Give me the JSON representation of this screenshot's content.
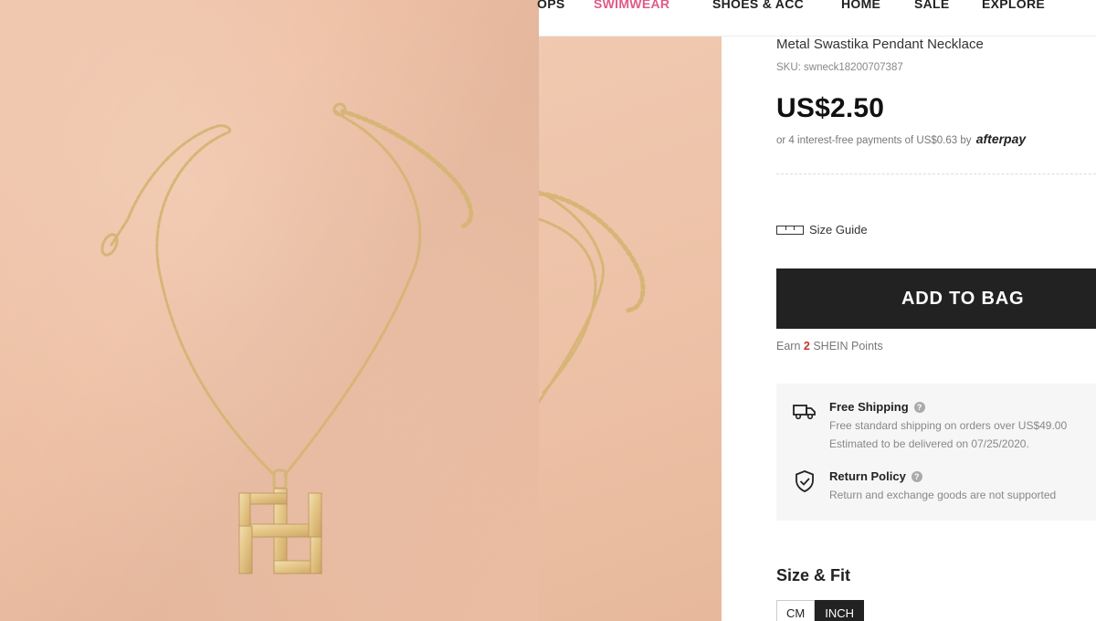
{
  "nav": {
    "items": [
      {
        "label": "OPS",
        "accent": false
      },
      {
        "label": "SWIMWEAR",
        "accent": true
      },
      {
        "label": "SHOES & ACC",
        "accent": false
      },
      {
        "label": "HOME",
        "accent": false
      },
      {
        "label": "SALE",
        "accent": false
      },
      {
        "label": "EXPLORE",
        "accent": false
      }
    ],
    "accent_color": "#e05b86"
  },
  "product": {
    "title": "Metal Swastika Pendant Necklace",
    "sku": "SKU: swneck18200707387",
    "price": "US$2.50",
    "installment_text": "or 4 interest-free payments of US$0.63 by",
    "installment_brand": "afterpay",
    "size_guide_label": "Size Guide",
    "add_to_bag_label": "ADD TO BAG",
    "earn_prefix": "Earn",
    "earn_points": "2",
    "earn_suffix": "SHEIN Points",
    "shipping": {
      "title": "Free Shipping",
      "line1": "Free standard shipping on orders over US$49.00",
      "line2": "Estimated to be delivered on 07/25/2020."
    },
    "returns": {
      "title": "Return Policy",
      "line1": "Return and exchange goods are not supported"
    },
    "size_fit_label": "Size & Fit",
    "units": [
      {
        "label": "CM",
        "active": false
      },
      {
        "label": "INCH",
        "active": true
      }
    ]
  },
  "icons": {
    "ruler": "ruler-icon",
    "truck": "truck-icon",
    "shield": "shield-check-icon",
    "help": "help-circle-icon"
  }
}
